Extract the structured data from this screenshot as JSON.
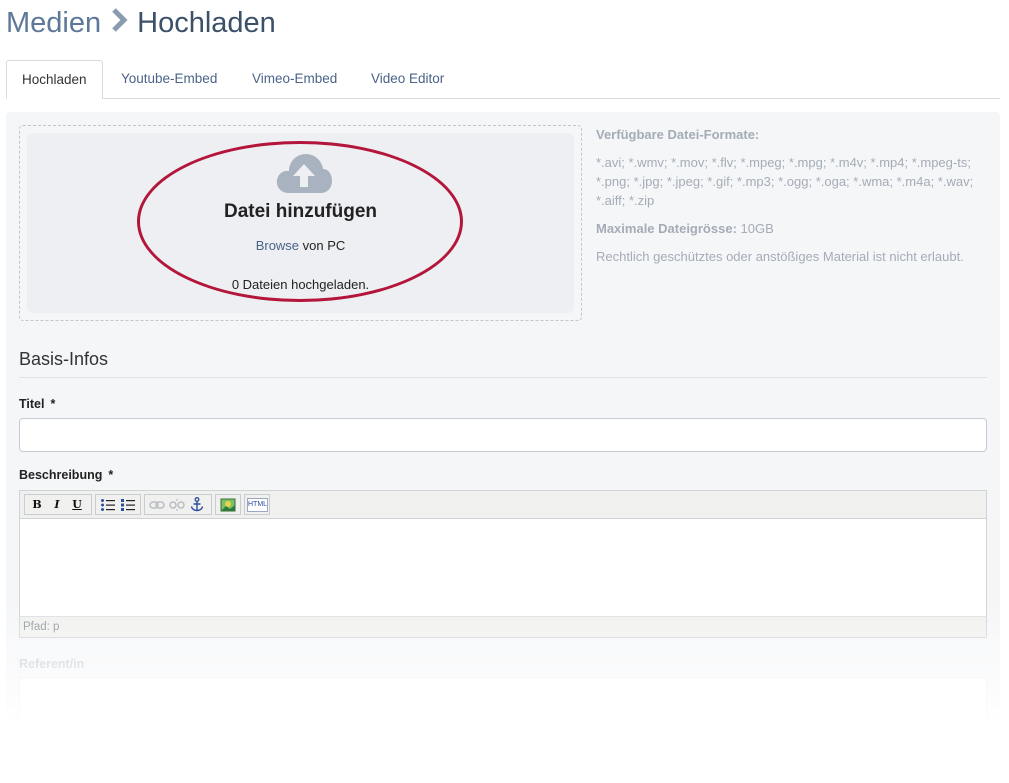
{
  "breadcrumb": {
    "root": "Medien",
    "separator": "❯",
    "current": "Hochladen"
  },
  "tabs": [
    {
      "label": "Hochladen",
      "active": true
    },
    {
      "label": "Youtube-Embed"
    },
    {
      "label": "Vimeo-Embed"
    },
    {
      "label": "Video Editor"
    }
  ],
  "dropzone": {
    "icon": "cloud-upload-icon",
    "title": "Datei hinzufügen",
    "browse_link": "Browse",
    "browse_suffix": " von PC",
    "count_text": "0 Dateien hochgeladen."
  },
  "info": {
    "formats_heading": "Verfügbare Datei-Formate:",
    "formats_list": "*.avi; *.wmv; *.mov; *.flv; *.mpeg; *.mpg; *.m4v; *.mp4; *.mpeg-ts; *.png; *.jpg; *.jpeg; *.gif; *.mp3; *.ogg; *.oga; *.wma; *.m4a; *.wav; *.aiff; *.zip",
    "maxsize_label": "Maximale Dateigrösse:",
    "maxsize_value": " 10GB",
    "legal_note": "Rechtlich geschütztes oder anstößiges Material ist nicht erlaubt."
  },
  "form": {
    "section_title": "Basis-Infos",
    "title_label": "Titel",
    "title_required": "*",
    "title_value": "",
    "description_label": "Beschreibung",
    "description_required": "*",
    "editor_path": "Pfad: p",
    "referent_label": "Referent/in"
  },
  "editor_toolbar": {
    "bold": "B",
    "italic": "I",
    "underline": "U",
    "html": "HTML"
  },
  "colors": {
    "accent": "#4a6388",
    "highlight_ellipse": "#b3163a",
    "panel_bg": "#f5f6f8"
  }
}
